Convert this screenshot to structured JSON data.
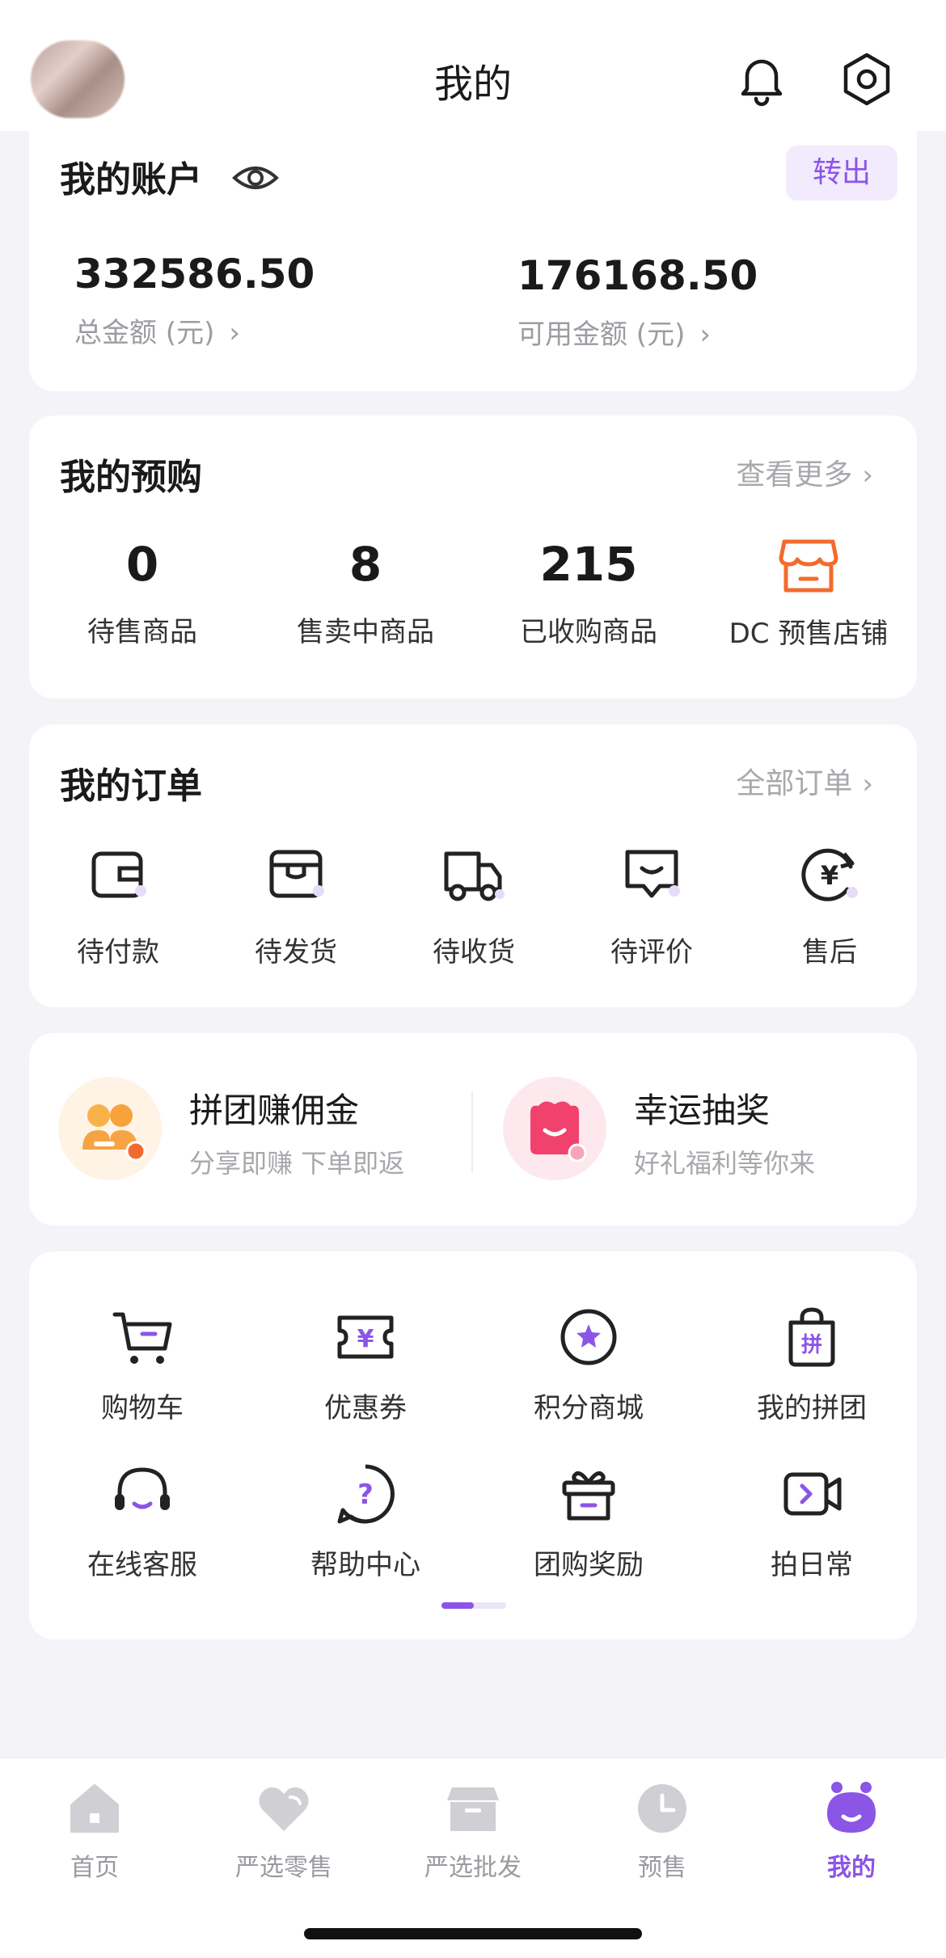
{
  "header": {
    "title": "我的"
  },
  "account": {
    "title": "我的账户",
    "transfer_label": "转出",
    "total_amount": "332586.50",
    "total_label": "总金额 (元)",
    "available_amount": "176168.50",
    "available_label": "可用金额 (元)"
  },
  "presale": {
    "title": "我的预购",
    "more_label": "查看更多",
    "stats": [
      {
        "value": "0",
        "label": "待售商品"
      },
      {
        "value": "8",
        "label": "售卖中商品"
      },
      {
        "value": "215",
        "label": "已收购商品"
      }
    ],
    "store_label": "DC 预售店铺"
  },
  "orders": {
    "title": "我的订单",
    "more_label": "全部订单",
    "items": [
      {
        "label": "待付款",
        "icon": "wallet-icon"
      },
      {
        "label": "待发货",
        "icon": "package-icon"
      },
      {
        "label": "待收货",
        "icon": "truck-icon"
      },
      {
        "label": "待评价",
        "icon": "comment-icon"
      },
      {
        "label": "售后",
        "icon": "refund-icon"
      }
    ]
  },
  "promo": {
    "left_title": "拼团赚佣金",
    "left_sub": "分享即赚 下单即返",
    "right_title": "幸运抽奖",
    "right_sub": "好礼福利等你来"
  },
  "services": {
    "items": [
      {
        "label": "购物车",
        "icon": "cart-icon"
      },
      {
        "label": "优惠券",
        "icon": "coupon-icon"
      },
      {
        "label": "积分商城",
        "icon": "points-mall-icon"
      },
      {
        "label": "我的拼团",
        "icon": "group-buy-icon"
      },
      {
        "label": "在线客服",
        "icon": "headset-icon"
      },
      {
        "label": "帮助中心",
        "icon": "help-icon"
      },
      {
        "label": "团购奖励",
        "icon": "gift-icon"
      },
      {
        "label": "拍日常",
        "icon": "video-icon"
      }
    ],
    "page_index": 1,
    "page_count": 2
  },
  "tabbar": {
    "items": [
      {
        "label": "首页",
        "icon": "home-icon"
      },
      {
        "label": "严选零售",
        "icon": "heart-icon"
      },
      {
        "label": "严选批发",
        "icon": "box-icon"
      },
      {
        "label": "预售",
        "icon": "clock-icon"
      },
      {
        "label": "我的",
        "icon": "mascot-icon"
      }
    ],
    "active_index": 4
  },
  "colors": {
    "accent": "#8b55e6",
    "orange": "#f26b2e",
    "background": "#f3f3f8"
  }
}
